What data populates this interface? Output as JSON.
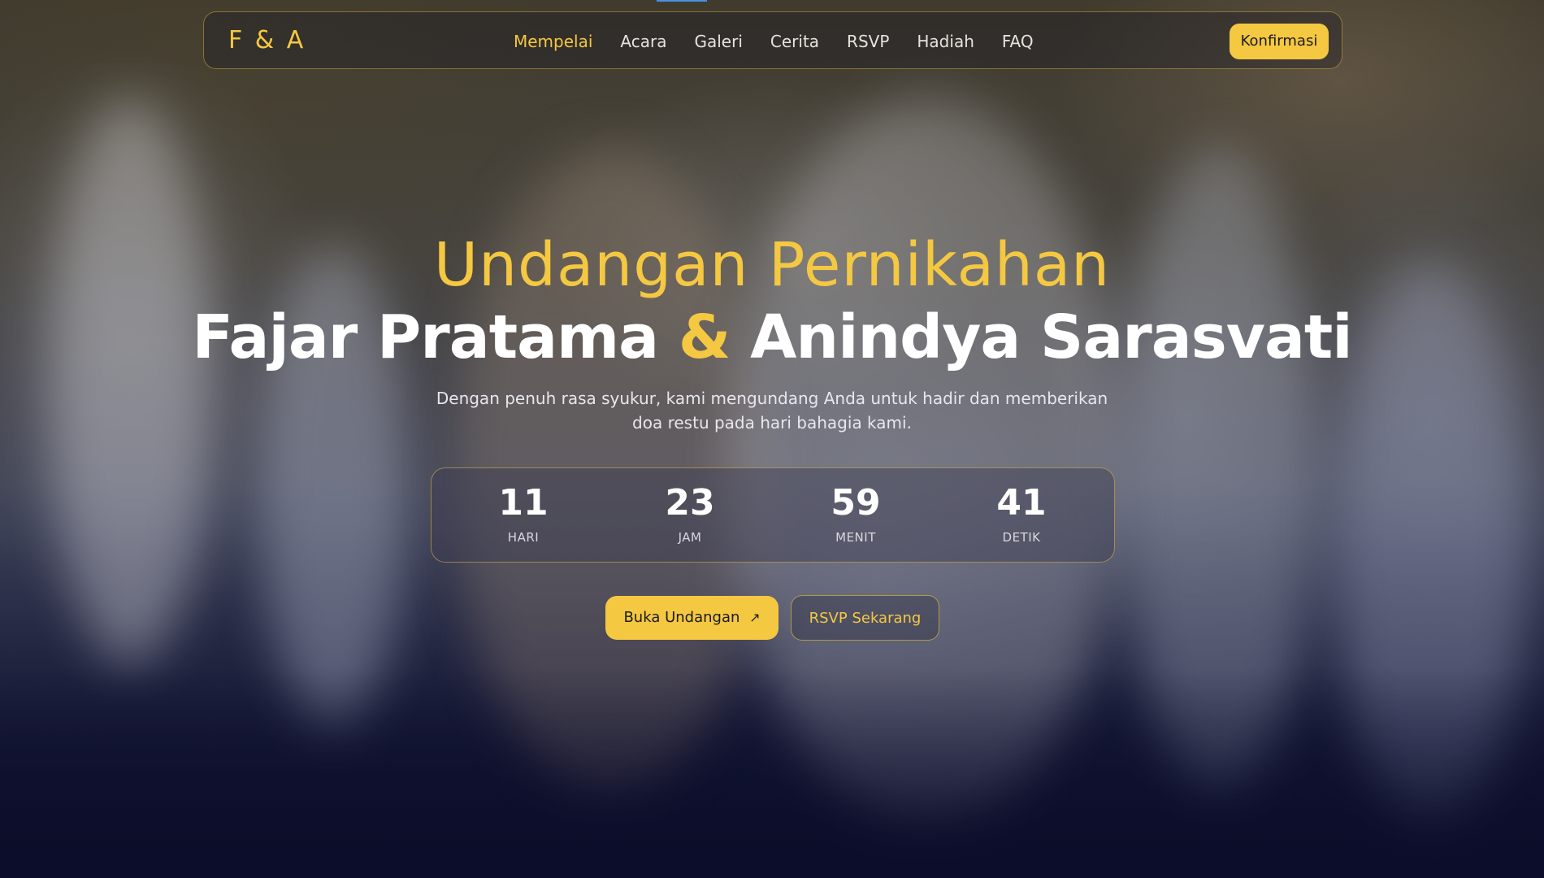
{
  "nav": {
    "logo": "F & A",
    "items": [
      {
        "label": "Mempelai",
        "active": true
      },
      {
        "label": "Acara",
        "active": false
      },
      {
        "label": "Galeri",
        "active": false
      },
      {
        "label": "Cerita",
        "active": false
      },
      {
        "label": "RSVP",
        "active": false
      },
      {
        "label": "Hadiah",
        "active": false
      },
      {
        "label": "FAQ",
        "active": false
      }
    ],
    "cta_label": "Konfirmasi"
  },
  "hero": {
    "title_line1": "Undangan Pernikahan",
    "groom": "Fajar Pratama",
    "ampersand": "&",
    "bride": "Anindya Sarasvati",
    "subtitle": "Dengan penuh rasa syukur, kami mengundang Anda untuk hadir dan memberikan doa restu pada hari bahagia kami."
  },
  "countdown": [
    {
      "value": "11",
      "label": "HARI"
    },
    {
      "value": "23",
      "label": "JAM"
    },
    {
      "value": "59",
      "label": "MENIT"
    },
    {
      "value": "41",
      "label": "DETIK"
    }
  ],
  "actions": {
    "open_label": "Buka Undangan",
    "open_icon": "↗",
    "rsvp_label": "RSVP Sekarang"
  },
  "colors": {
    "accent": "#f5c842",
    "background": "#0b0d2a"
  }
}
